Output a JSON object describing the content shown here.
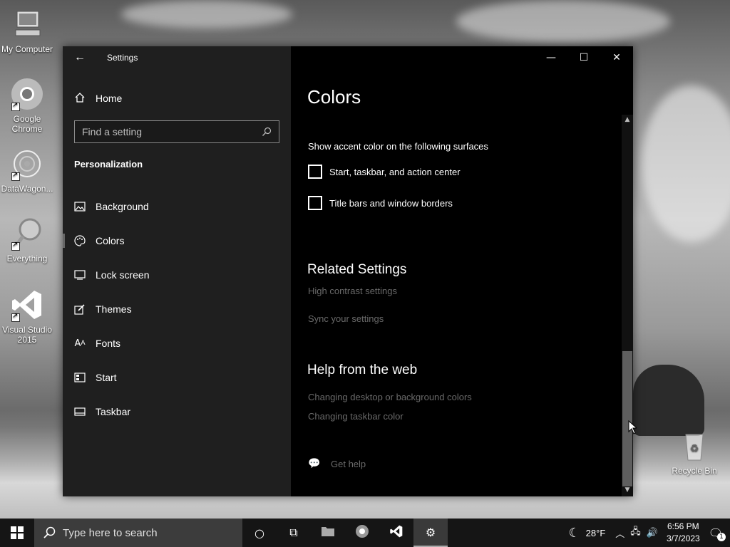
{
  "desktop": {
    "icons": [
      {
        "label": "My Computer"
      },
      {
        "label": "Google Chrome"
      },
      {
        "label": "DataWagon..."
      },
      {
        "label": "Everything"
      },
      {
        "label": "Visual Studio 2015"
      },
      {
        "label": "Recycle Bin"
      }
    ]
  },
  "window": {
    "title": "Settings",
    "controls": {
      "minimize": "—",
      "maximize": "☐",
      "close": "✕"
    }
  },
  "nav": {
    "home": "Home",
    "search_placeholder": "Find a setting",
    "section": "Personalization",
    "items": [
      {
        "label": "Background",
        "icon": "image-icon"
      },
      {
        "label": "Colors",
        "icon": "palette-icon",
        "selected": true
      },
      {
        "label": "Lock screen",
        "icon": "lock-screen-icon"
      },
      {
        "label": "Themes",
        "icon": "themes-icon"
      },
      {
        "label": "Fonts",
        "icon": "fonts-icon"
      },
      {
        "label": "Start",
        "icon": "start-icon"
      },
      {
        "label": "Taskbar",
        "icon": "taskbar-icon"
      }
    ]
  },
  "content": {
    "title": "Colors",
    "accent_heading": "Show accent color on the following surfaces",
    "checkboxes": [
      {
        "label": "Start, taskbar, and action center",
        "checked": false
      },
      {
        "label": "Title bars and window borders",
        "checked": false
      }
    ],
    "related": {
      "heading": "Related Settings",
      "links": [
        "High contrast settings",
        "Sync your settings"
      ]
    },
    "help": {
      "heading": "Help from the web",
      "links": [
        "Changing desktop or background colors",
        "Changing taskbar color"
      ]
    },
    "get_help": "Get help"
  },
  "taskbar": {
    "search_placeholder": "Type here to search",
    "weather": "28°F",
    "time": "6:56 PM",
    "date": "3/7/2023",
    "notification_count": "1"
  }
}
